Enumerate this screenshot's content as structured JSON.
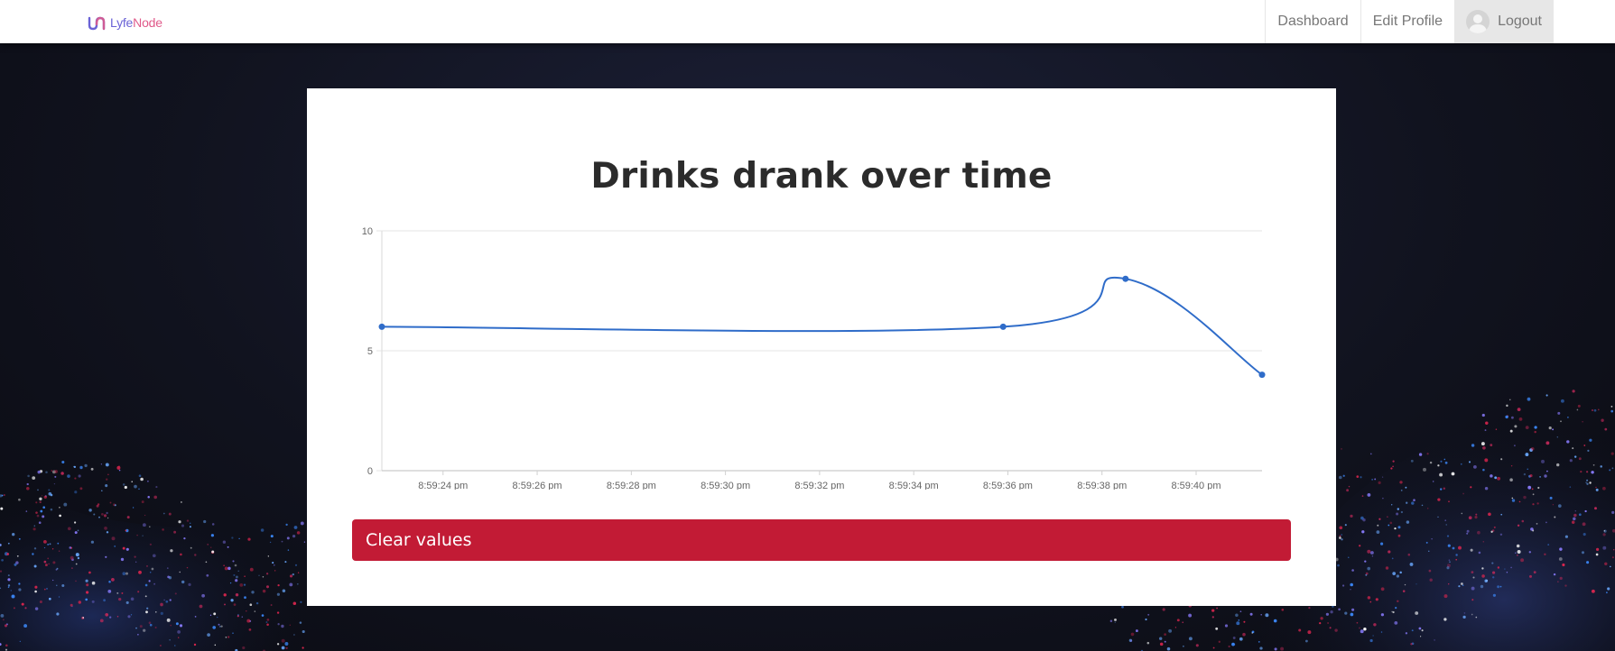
{
  "navbar": {
    "brand": {
      "part1": "Lyfe",
      "part2": "Node"
    },
    "links": [
      {
        "label": "Dashboard"
      },
      {
        "label": "Edit Profile"
      },
      {
        "label": "Logout"
      }
    ]
  },
  "card": {
    "clear_button_label": "Clear values"
  },
  "colors": {
    "line": "#2f6cc9",
    "button": "#c21b35",
    "brand_purple": "#6a63d6",
    "brand_pink": "#e05a8a"
  },
  "chart_data": {
    "type": "line",
    "title": "Drinks drank over time",
    "xlabel": "",
    "ylabel": "",
    "ylim": [
      0,
      10
    ],
    "y_ticks": [
      "0",
      "5",
      "10"
    ],
    "x_tick_labels": [
      "8:59:24 pm",
      "8:59:26 pm",
      "8:59:28 pm",
      "8:59:30 pm",
      "8:59:32 pm",
      "8:59:34 pm",
      "8:59:36 pm",
      "8:59:38 pm",
      "8:59:40 pm"
    ],
    "x_range": [
      "8:59:22.7 pm",
      "8:59:41.4 pm"
    ],
    "grid": true,
    "legend": "none",
    "series": [
      {
        "points": [
          {
            "x": "8:59:22.7 pm",
            "y": 6
          },
          {
            "x": "8:59:35.9 pm",
            "y": 6
          },
          {
            "x": "8:59:38.5 pm",
            "y": 8
          },
          {
            "x": "8:59:41.4 pm",
            "y": 4
          }
        ]
      }
    ]
  }
}
